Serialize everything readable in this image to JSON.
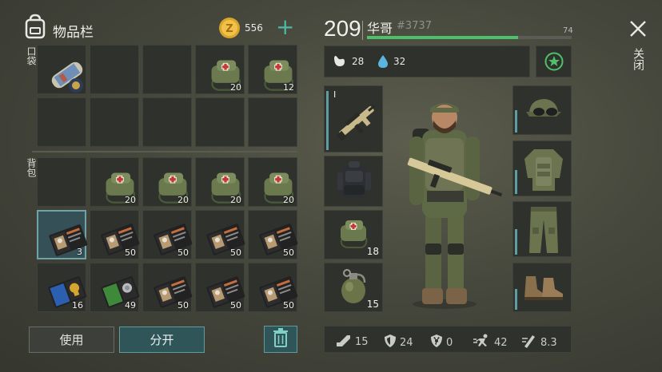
{
  "inventory": {
    "title": "物品栏",
    "coins": "556",
    "plus_label": "+",
    "pocket_label": "口袋",
    "backpack_label": "背包",
    "pocket_slots": [
      {
        "icon": "rolled-map-icon",
        "count": ""
      },
      {
        "icon": "empty",
        "count": ""
      },
      {
        "icon": "empty",
        "count": ""
      },
      {
        "icon": "medkit-bag-icon",
        "count": "20"
      },
      {
        "icon": "medkit-bag-icon",
        "count": "12"
      },
      {
        "icon": "empty",
        "count": ""
      },
      {
        "icon": "empty",
        "count": ""
      },
      {
        "icon": "empty",
        "count": ""
      },
      {
        "icon": "empty",
        "count": ""
      },
      {
        "icon": "empty",
        "count": ""
      }
    ],
    "backpack_slots": [
      {
        "icon": "empty",
        "count": ""
      },
      {
        "icon": "medkit-bag-icon",
        "count": "20"
      },
      {
        "icon": "medkit-bag-icon",
        "count": "20"
      },
      {
        "icon": "medkit-bag-icon",
        "count": "20"
      },
      {
        "icon": "medkit-bag-icon",
        "count": "20"
      },
      {
        "icon": "wallet-icon",
        "count": "3"
      },
      {
        "icon": "wallet-icon",
        "count": "50"
      },
      {
        "icon": "wallet-icon",
        "count": "50"
      },
      {
        "icon": "wallet-icon",
        "count": "50"
      },
      {
        "icon": "wallet-icon",
        "count": "50"
      },
      {
        "icon": "wallet-badge-blue-icon",
        "count": "16"
      },
      {
        "icon": "wallet-green-icon",
        "count": "49"
      },
      {
        "icon": "wallet-icon",
        "count": "50"
      },
      {
        "icon": "wallet-icon",
        "count": "50"
      },
      {
        "icon": "wallet-icon",
        "count": "50"
      }
    ],
    "use_label": "使用",
    "split_label": "分开"
  },
  "player": {
    "level": "209",
    "name": "华哥",
    "id": "#3737",
    "health": "74",
    "hunger": "28",
    "thirst": "32",
    "health_fill": 0.74
  },
  "gear": {
    "weapon_tier": "I",
    "medkit_count": "18",
    "grenade_count": "15"
  },
  "stats": {
    "attack": "15",
    "defense": "24",
    "radiation": "0",
    "speed": "42",
    "stealth": "8.3"
  },
  "close_label": "关闭",
  "colors": {
    "accent": "#5e9ea3",
    "health": "#4ec06a",
    "selected": "#6fa3a8"
  }
}
